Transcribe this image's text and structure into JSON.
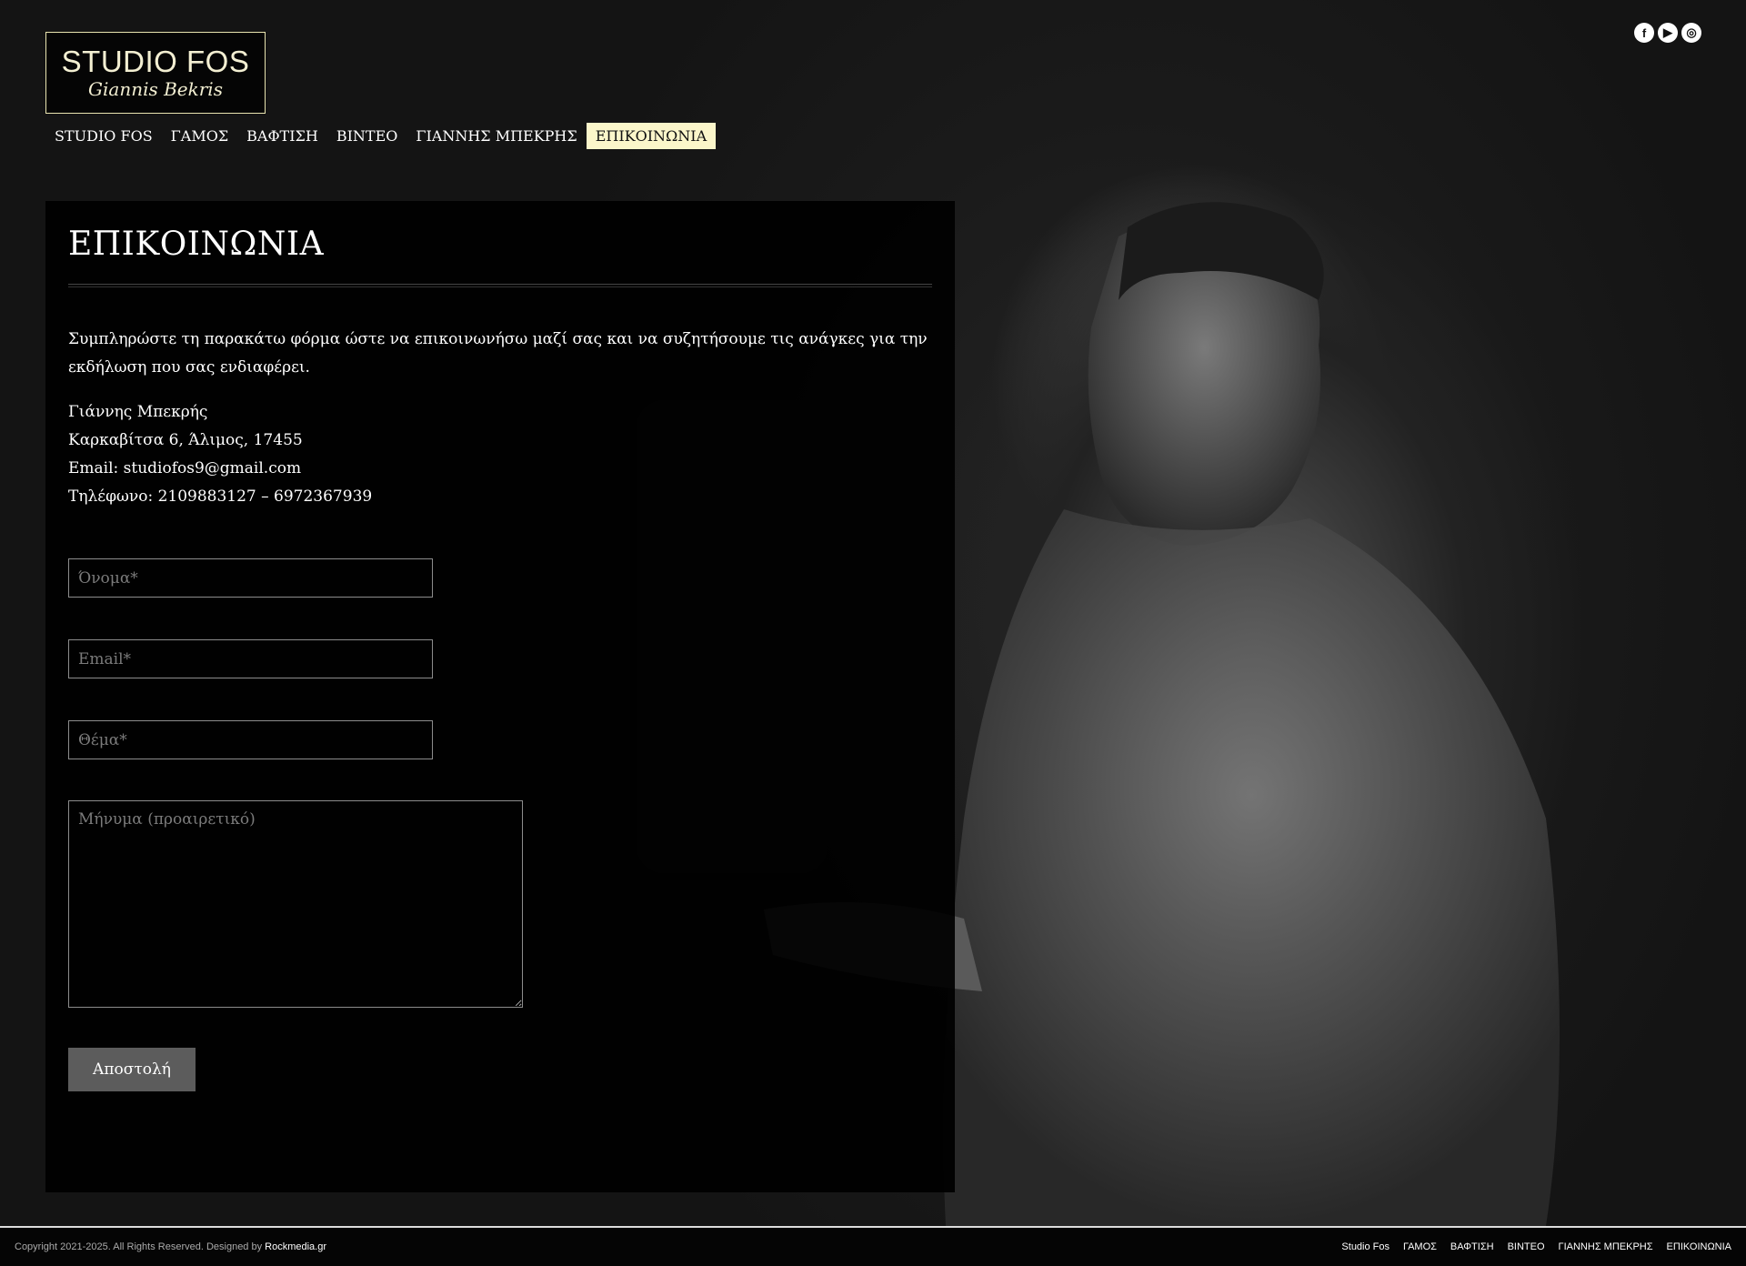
{
  "logo": {
    "main": "STUDIO FOS",
    "sub": "Giannis Bekris"
  },
  "social": [
    {
      "icon": "facebook-icon",
      "glyph": "f"
    },
    {
      "icon": "youtube-icon",
      "glyph": "▶"
    },
    {
      "icon": "instagram-icon",
      "glyph": "◎"
    }
  ],
  "nav": [
    "STUDIO FOS",
    "ΓΑΜΟΣ",
    "ΒΑΦΤΙΣΗ",
    "ΒΙΝΤΕΟ",
    "ΓΙΑΝΝΗΣ ΜΠΕΚΡΗΣ",
    "ΕΠΙΚΟΙΝΩΝΙΑ"
  ],
  "page": {
    "title": "ΕΠΙΚΟΙΝΩΝΙΑ",
    "intro": "Συμπληρώστε τη παρακάτω φόρμα ώστε να επικοινωνήσω μαζί σας και να συζητήσουμε τις ανάγκες για την εκδήλωση που σας ενδιαφέρει.",
    "contact": {
      "name": "Γιάννης Μπεκρής",
      "address": "Καρκαβίτσα 6, Άλιμος, 17455",
      "email": "Email: studiofos9@gmail.com",
      "phone": "Τηλέφωνο: 2109883127 – 6972367939"
    }
  },
  "form": {
    "name_placeholder": "Όνομα*",
    "email_placeholder": "Email*",
    "subject_placeholder": "Θέμα*",
    "message_placeholder": "Μήνυμα (προαιρετικό)",
    "submit_label": "Αποστολή"
  },
  "footer": {
    "copyright": "Copyright 2021-2025. All Rights Reserved. Designed by ",
    "designer": "Rockmedia.gr",
    "nav": [
      "Studio Fos",
      "ΓΑΜΟΣ",
      "ΒΑΦΤΙΣΗ",
      "ΒΙΝΤΕΟ",
      "ΓΙΑΝΝΗΣ ΜΠΕΚΡΗΣ",
      "ΕΠΙΚΟΙΝΩΝΙΑ"
    ]
  },
  "colors": {
    "accent": "#fbf6ca",
    "logo_border": "#e9e4b0",
    "button": "#5c5c5c"
  }
}
